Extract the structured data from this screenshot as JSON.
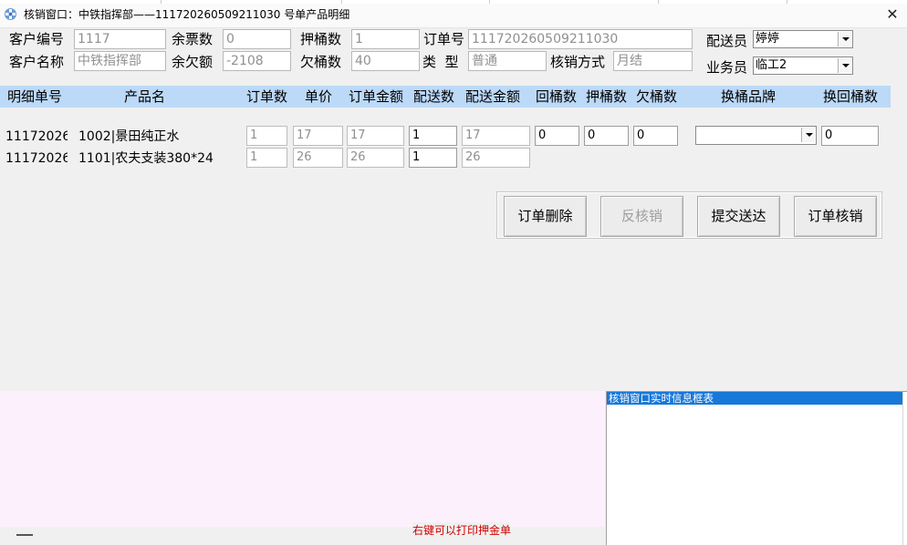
{
  "window": {
    "title": "核销窗口：中铁指挥部——111720260509211030 号单产品明细",
    "close_glyph": "✕"
  },
  "form": {
    "customer_no_label": "客户编号",
    "customer_no": "1117",
    "ticket_balance_label": "余票数",
    "ticket_balance": "0",
    "deposit_buckets_label": "押桶数",
    "deposit_buckets": "1",
    "order_no_label": "订单号",
    "order_no": "111720260509211030",
    "deliverer_label": "配送员",
    "deliverer": "婷婷",
    "customer_name_label": "客户名称",
    "customer_name": "中铁指挥部",
    "owed_amount_label": "余欠额",
    "owed_amount": "-2108",
    "owed_buckets_label": "欠桶数",
    "owed_buckets": "40",
    "type_label": "类  型",
    "type": "普通",
    "settle_method_label": "核销方式",
    "settle_method": "月结",
    "salesman_label": "业务员",
    "salesman": "临工2"
  },
  "grid": {
    "columns": [
      "明细单号",
      "产品名",
      "订单数",
      "单价",
      "订单金额",
      "配送数",
      "配送金额",
      "回桶数",
      "押桶数",
      "欠桶数",
      "换桶品牌",
      "换回桶数"
    ],
    "rows": [
      {
        "detail_no": "11172026(",
        "product": "1002|景田纯正水",
        "order_qty": "1",
        "price": "17",
        "order_amount": "17",
        "delivery_qty": "1",
        "delivery_amount": "17",
        "return_buckets": "0",
        "deposit_buckets": "0",
        "owed_buckets": "0",
        "swap_brand": "",
        "swap_return": "0"
      },
      {
        "detail_no": "11172026(",
        "product": "1101|农夫支装380*24",
        "order_qty": "1",
        "price": "26",
        "order_amount": "26",
        "delivery_qty": "1",
        "delivery_amount": "26"
      }
    ]
  },
  "actions": {
    "delete": "订单删除",
    "unsettle": "反核销",
    "submit": "提交送达",
    "settle": "订单核销"
  },
  "footer": {
    "print_hint": "右键可以打印押金单",
    "info_title": "核销窗口实时信息框表"
  },
  "colors": {
    "header_bg": "#bcd9f7",
    "info_title_bg": "#1878d8",
    "hint_text": "#d00000",
    "pink_pane": "#fdf0fd"
  }
}
